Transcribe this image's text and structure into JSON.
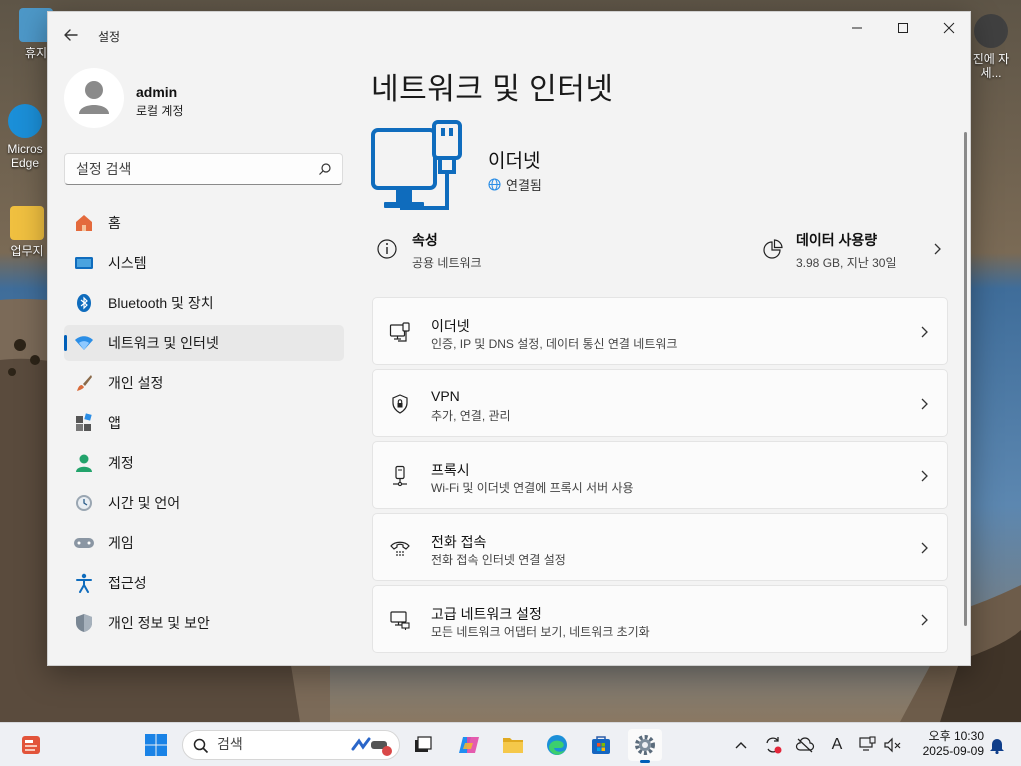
{
  "desktop": {
    "icons": [
      {
        "label": "휴지",
        "color": "#4aa3df"
      },
      {
        "label": "Micros Edge",
        "color": "#1b8fd8"
      },
      {
        "label": "업무지",
        "color": "#f0c040"
      },
      {
        "label": "진에 자세...",
        "color": "#404040"
      }
    ]
  },
  "window": {
    "app_title": "설정",
    "back_icon": "back-arrow-icon",
    "controls": {
      "minimize": "—",
      "maximize": "☐",
      "close": "✕"
    }
  },
  "profile": {
    "name": "admin",
    "account_type": "로컬 계정"
  },
  "search": {
    "placeholder": "설정 검색"
  },
  "sidebar": {
    "items": [
      {
        "label": "홈",
        "icon": "home-icon",
        "active": false
      },
      {
        "label": "시스템",
        "icon": "system-icon",
        "active": false
      },
      {
        "label": "Bluetooth 및 장치",
        "icon": "bluetooth-icon",
        "active": false
      },
      {
        "label": "네트워크 및 인터넷",
        "icon": "wifi-icon",
        "active": true
      },
      {
        "label": "개인 설정",
        "icon": "brush-icon",
        "active": false
      },
      {
        "label": "앱",
        "icon": "apps-icon",
        "active": false
      },
      {
        "label": "계정",
        "icon": "account-icon",
        "active": false
      },
      {
        "label": "시간 및 언어",
        "icon": "clock-globe-icon",
        "active": false
      },
      {
        "label": "게임",
        "icon": "gamepad-icon",
        "active": false
      },
      {
        "label": "접근성",
        "icon": "accessibility-icon",
        "active": false
      },
      {
        "label": "개인 정보 및 보안",
        "icon": "shield-icon",
        "active": false
      }
    ]
  },
  "main": {
    "page_title": "네트워크 및 인터넷",
    "hero": {
      "name": "이더넷",
      "status": "연결됨"
    },
    "properties": {
      "title": "속성",
      "subtitle": "공용 네트워크"
    },
    "data_usage": {
      "title": "데이터 사용량",
      "subtitle": "3.98 GB, 지난 30일"
    },
    "cards": [
      {
        "title": "이더넷",
        "subtitle": "인증, IP 및 DNS 설정, 데이터 통신 연결 네트워크",
        "icon": "ethernet-icon"
      },
      {
        "title": "VPN",
        "subtitle": "추가, 연결, 관리",
        "icon": "vpn-shield-icon"
      },
      {
        "title": "프록시",
        "subtitle": "Wi-Fi 및 이더넷 연결에 프록시 서버 사용",
        "icon": "proxy-icon"
      },
      {
        "title": "전화 접속",
        "subtitle": "전화 접속 인터넷 연결 설정",
        "icon": "dialup-icon"
      },
      {
        "title": "고급 네트워크 설정",
        "subtitle": "모든 네트워크 어댑터 보기, 네트워크 초기화",
        "icon": "advanced-network-icon"
      }
    ]
  },
  "taskbar": {
    "search_placeholder": "검색",
    "time": "오후 10:30",
    "date": "2025-09-09",
    "ime": "A"
  },
  "colors": {
    "accent": "#005fb8",
    "hero_blue": "#0f6cbd"
  }
}
